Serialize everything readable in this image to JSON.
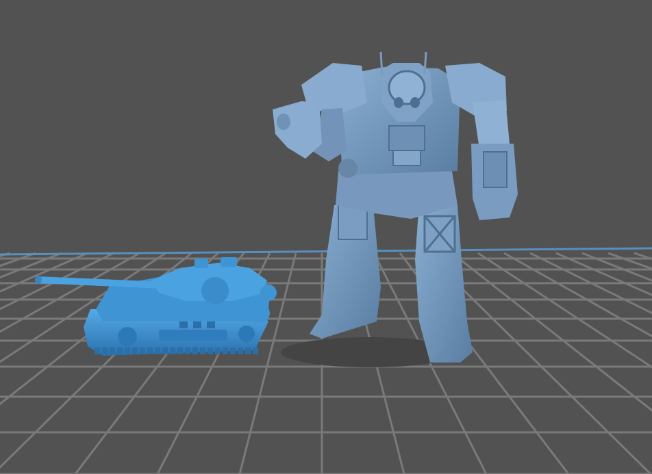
{
  "viewport": {
    "background_color": "#525252",
    "grid_line_color": "#7a7a7a",
    "build_plate_edge_color": "#5a8fbd"
  },
  "models": {
    "tank": {
      "name": "tank-model",
      "color": "#3a8fd0",
      "shadow_color": "#2b6fa8"
    },
    "mech": {
      "name": "mech-model",
      "color": "#6a90b5",
      "shadow_color": "#4d6f92"
    }
  }
}
